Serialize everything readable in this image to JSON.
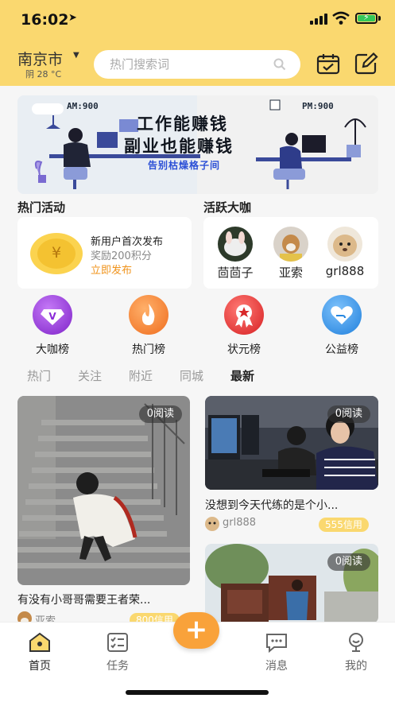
{
  "status_bar": {
    "time": "16:02"
  },
  "header": {
    "city": "南京市",
    "weather": "阴 28 °C",
    "search_placeholder": "热门搜索词"
  },
  "banner": {
    "am_tag": "AM:900",
    "pm_tag": "PM:900",
    "line1": "工作能赚钱",
    "line2": "副业也能赚钱",
    "line3": "告别枯燥格子间"
  },
  "hot_activity": {
    "title": "热门活动",
    "headline": "新用户首次发布",
    "reward": "奖励200积分",
    "cta": "立即发布"
  },
  "active_stars": {
    "title": "活跃大咖",
    "users": [
      {
        "name": "茴茴子"
      },
      {
        "name": "亚索"
      },
      {
        "name": "grl888"
      }
    ]
  },
  "rankings": [
    {
      "label": "大咖榜",
      "icon": "v-diamond-icon",
      "color": "#9b3de0"
    },
    {
      "label": "热门榜",
      "icon": "flame-icon",
      "color": "#f27a2a"
    },
    {
      "label": "状元榜",
      "icon": "ribbon-star-icon",
      "color": "#e2302c"
    },
    {
      "label": "公益榜",
      "icon": "heart-hands-icon",
      "color": "#2f8fe6"
    }
  ],
  "tabs": [
    {
      "label": "热门"
    },
    {
      "label": "关注"
    },
    {
      "label": "附近"
    },
    {
      "label": "同城"
    },
    {
      "label": "最新"
    }
  ],
  "feed": [
    {
      "read": "0阅读",
      "title": "有没有小哥哥需要王者荣...",
      "author": "亚索",
      "credit": "800信用"
    },
    {
      "read": "0阅读",
      "title": "没想到今天代练的是个小...",
      "author": "grl888",
      "credit": "555信用"
    },
    {
      "read": "0阅读"
    }
  ],
  "nav": [
    {
      "label": "首页"
    },
    {
      "label": "任务"
    },
    {
      "label": "消息"
    },
    {
      "label": "我的"
    }
  ],
  "colors": {
    "brand": "#fad86f",
    "accent": "#f9a23a",
    "cta": "#f0931b"
  }
}
